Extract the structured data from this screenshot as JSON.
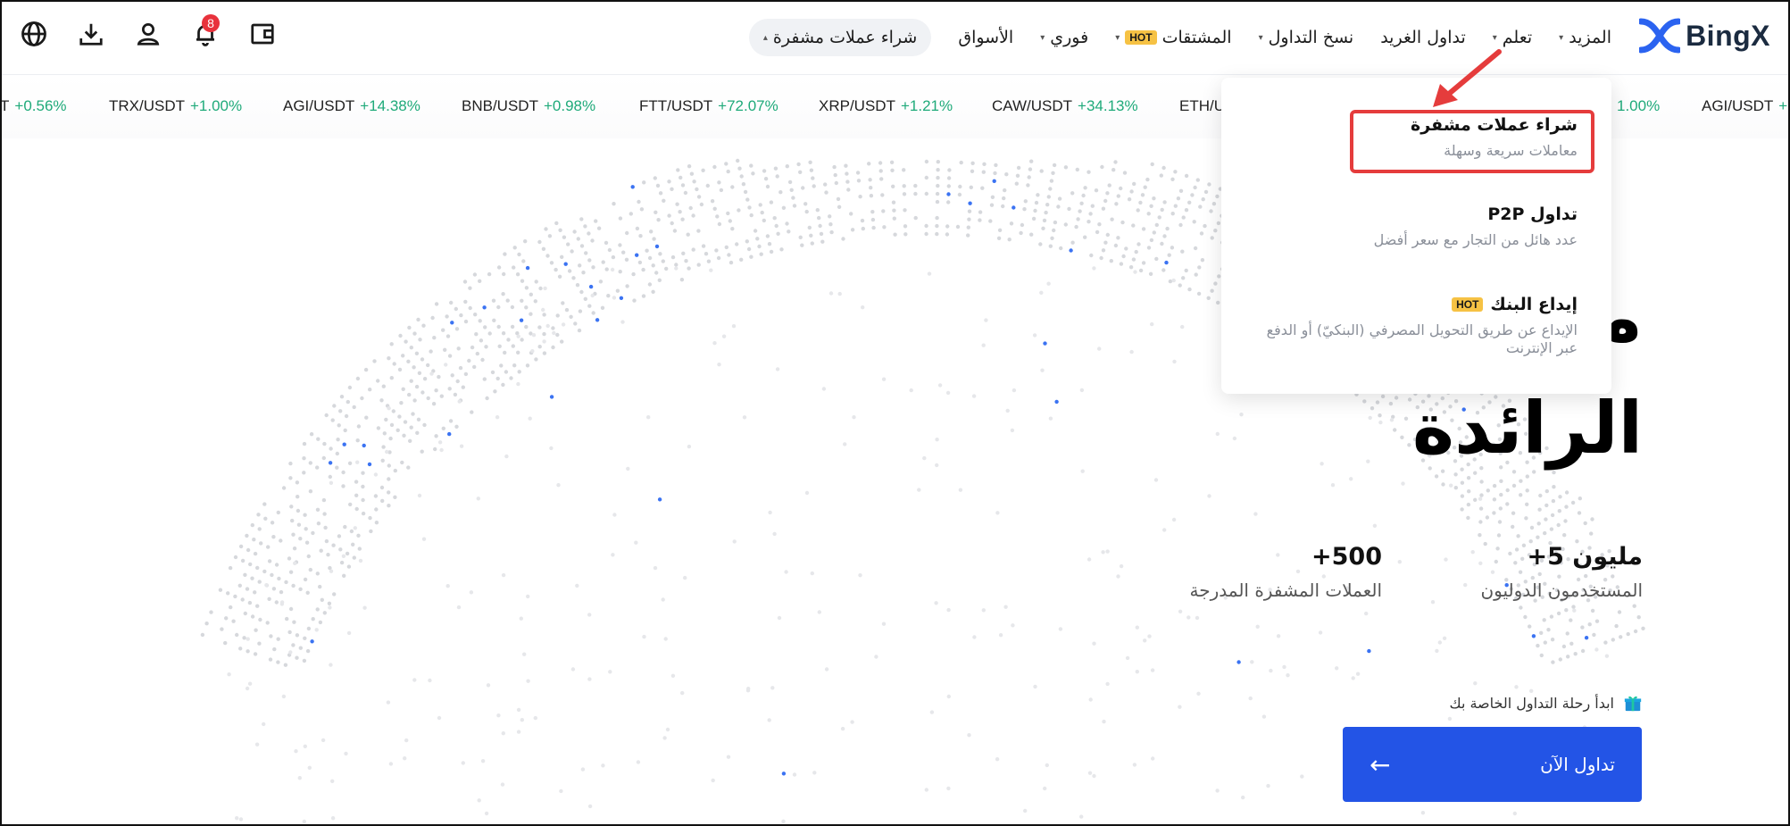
{
  "header": {
    "logo_text": "BingX",
    "notification_count": "8",
    "nav": [
      {
        "label": "شراء عملات مشفرة",
        "caret": "▴",
        "active": true,
        "hot": false
      },
      {
        "label": "الأسواق",
        "caret": "",
        "active": false,
        "hot": false
      },
      {
        "label": "فوري",
        "caret": "▾",
        "active": false,
        "hot": false
      },
      {
        "label": "المشتقات",
        "caret": "▾",
        "active": false,
        "hot": true
      },
      {
        "label": "نسخ التداول",
        "caret": "▾",
        "active": false,
        "hot": false
      },
      {
        "label": "تداول الغريد",
        "caret": "",
        "active": false,
        "hot": false
      },
      {
        "label": "تعلم",
        "caret": "▾",
        "active": false,
        "hot": false
      },
      {
        "label": "المزيد",
        "caret": "▾",
        "active": false,
        "hot": false
      }
    ],
    "hot_label": "HOT",
    "icons": [
      "globe-icon",
      "download-icon",
      "user-icon",
      "bell-icon",
      "wallet-icon"
    ]
  },
  "ticker": [
    {
      "pair": "T",
      "change": "+0.56%"
    },
    {
      "pair": "TRX/USDT",
      "change": "+1.00%"
    },
    {
      "pair": "AGI/USDT",
      "change": "+14.38%"
    },
    {
      "pair": "BNB/USDT",
      "change": "+0.98%"
    },
    {
      "pair": "FTT/USDT",
      "change": "+72.07%"
    },
    {
      "pair": "XRP/USDT",
      "change": "+1.21%"
    },
    {
      "pair": "CAW/USDT",
      "change": "+34.13%"
    },
    {
      "pair": "ETH/U",
      "change": ""
    },
    {
      "pair": "",
      "change": "1.00%"
    },
    {
      "pair": "AGI/USDT",
      "change": "+1"
    }
  ],
  "hero": {
    "title_line1": "م المشفرة",
    "title_line2": "الرائدة",
    "stats": [
      {
        "value": "مليون 5+",
        "label": "المستخدمون الدوليون"
      },
      {
        "value": "500+",
        "label": "العملات المشفرة المدرجة"
      }
    ],
    "cta_hint": "ابدأ رحلة التداول الخاصة بك",
    "cta_button": "تداول الآن",
    "cta_arrow": "←"
  },
  "dropdown": {
    "items": [
      {
        "title": "شراء عملات مشفرة",
        "subtitle": "معاملات سريعة وسهلة",
        "hot": false
      },
      {
        "title": "تداول P2P",
        "subtitle": "عدد هائل من التجار مع سعر أفضل",
        "hot": false
      },
      {
        "title": "إيداع البنك",
        "subtitle": "الإيداع عن طريق التحويل المصرفي (البنكيّ) أو الدفع عبر الإنترنت",
        "hot": true
      }
    ]
  },
  "colors": {
    "accent": "#2354e6",
    "positive": "#1faa7a",
    "hot_badge": "#f6c244",
    "annotation": "#e53c3c",
    "notification_badge": "#e8323c"
  }
}
